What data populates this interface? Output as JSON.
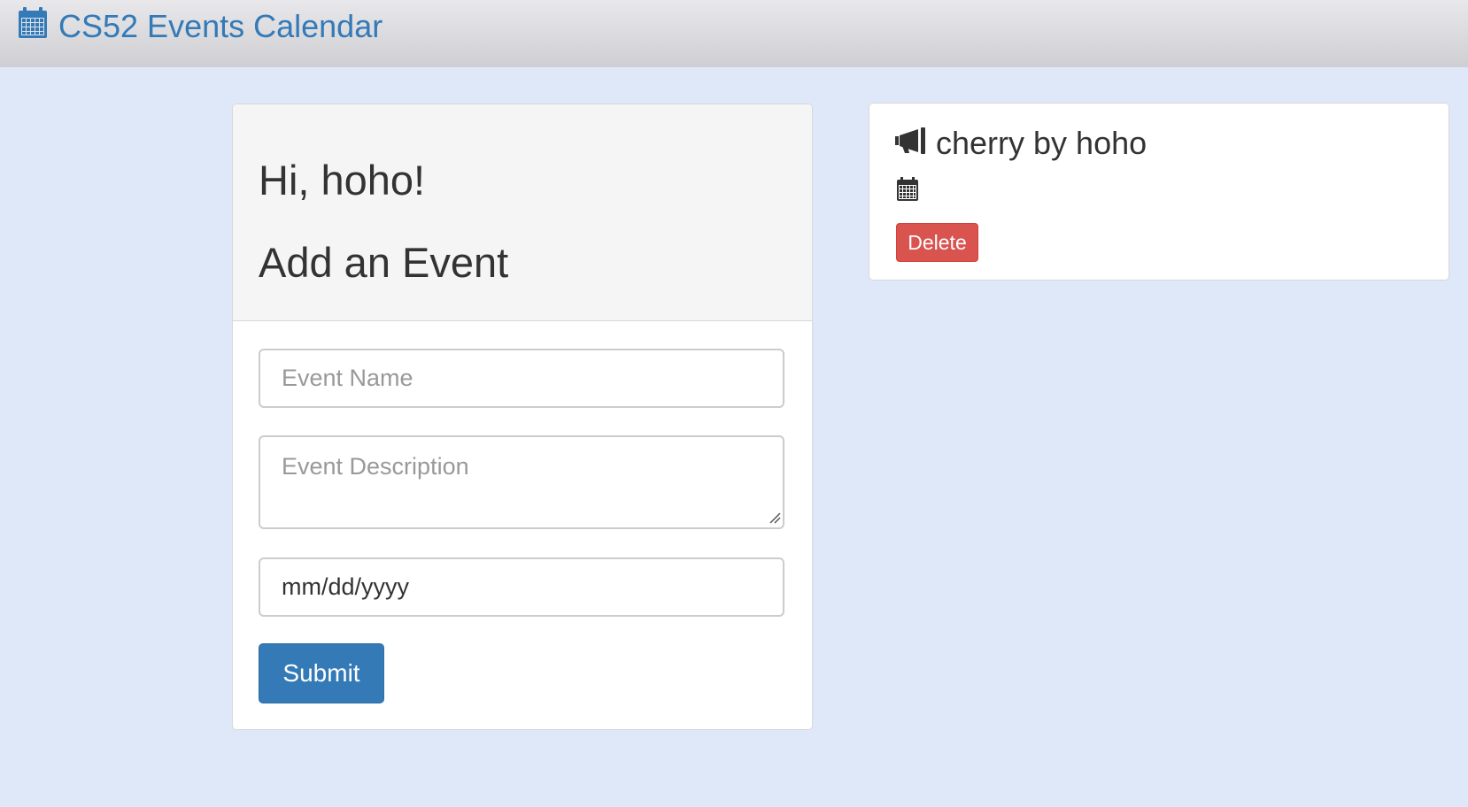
{
  "navbar": {
    "brand_icon": "calendar-icon",
    "brand_title": "CS52 Events Calendar",
    "brand_color": "#337ab7"
  },
  "form_panel": {
    "greeting": "Hi, hoho!",
    "heading": "Add an Event",
    "name_placeholder": "Event Name",
    "description_placeholder": "Event Description",
    "date_value": "mm/dd/yyyy",
    "submit_label": "Submit",
    "submit_color": "#337ab7"
  },
  "event_card": {
    "title_icon": "bullhorn-icon",
    "title": "cherry by hoho",
    "date_icon": "calendar-icon",
    "delete_label": "Delete",
    "delete_color": "#d9534f"
  },
  "colors": {
    "page_background": "#dfe8f8"
  }
}
